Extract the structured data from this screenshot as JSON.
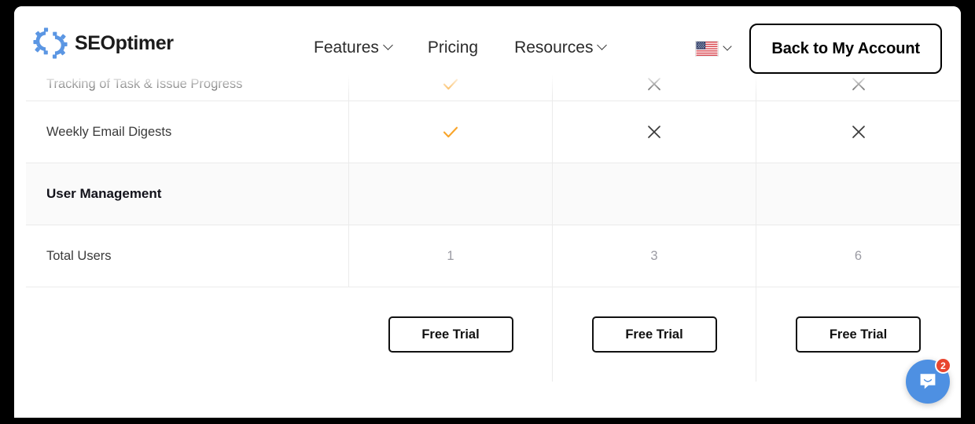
{
  "header": {
    "logo_text": "SEOptimer",
    "logo_icon": "gear-swirl-logo-icon",
    "nav": [
      {
        "label": "Features",
        "has_dropdown": true
      },
      {
        "label": "Pricing",
        "has_dropdown": false
      },
      {
        "label": "Resources",
        "has_dropdown": true
      }
    ],
    "language": {
      "icon": "us-flag-icon",
      "has_dropdown": true
    },
    "account_button": "Back to My Account"
  },
  "table": {
    "rows": [
      {
        "type": "feature",
        "label": "Tracking of Task & Issue Progress",
        "values": [
          "check",
          "x",
          "x"
        ],
        "clipped": true
      },
      {
        "type": "feature",
        "label": "Weekly Email Digests",
        "values": [
          "check",
          "x",
          "x"
        ]
      },
      {
        "type": "section",
        "label": "User Management",
        "values": [
          "",
          "",
          ""
        ]
      },
      {
        "type": "feature",
        "label": "Total Users",
        "values": [
          "1",
          "3",
          "6"
        ]
      }
    ],
    "cta_label": "Free Trial",
    "cta_count": 3
  },
  "chat": {
    "icon": "chat-bubble-icon",
    "unread_count": "2"
  },
  "colors": {
    "check": "#f9a52b",
    "x": "#3a3a3a",
    "accent_blue": "#4e90e2",
    "badge_red": "#e8452f",
    "section_bg": "#fafafa",
    "border": "#ebebeb"
  }
}
